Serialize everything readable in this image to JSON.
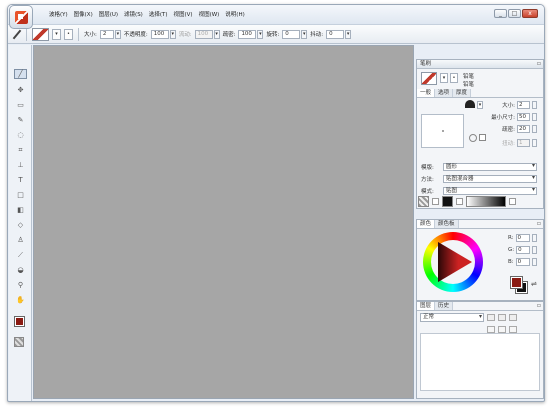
{
  "menu": [
    "波格(Y)",
    "图像(X)",
    "图层(U)",
    "滤镜(S)",
    "选择(T)",
    "视图(V)",
    "视图(W)",
    "说明(H)"
  ],
  "window_buttons": [
    "_",
    "□",
    "x"
  ],
  "options": {
    "size_label": "大小:",
    "size_value": "2",
    "opacity_label": "不透明度:",
    "opacity_value": "100",
    "flow_label": "流动:",
    "flow_value": "100",
    "density_label": "疏密:",
    "density_value": "100",
    "rotate_label": "旋转:",
    "rotate_value": "0",
    "offset_label": "抖动:",
    "offset_value": "0"
  },
  "brush_panel": {
    "title": "笔刷",
    "name_line1": "铅笔",
    "name_line2": "铅笔",
    "tabs": [
      "一般",
      "选项",
      "厚度"
    ],
    "rows": [
      {
        "label": "大小:",
        "value": "2"
      },
      {
        "label": "最小尺寸:",
        "value": "50"
      },
      {
        "label": "疏密:",
        "value": "20"
      },
      {
        "label": "扭动:",
        "value": "1"
      }
    ],
    "selects": [
      {
        "label": "模版:",
        "value": "圆形"
      },
      {
        "label": "方法:",
        "value": "贴图混合器"
      },
      {
        "label": "模式:",
        "value": "贴图"
      }
    ]
  },
  "color_panel": {
    "tabs": [
      "颜色",
      "颜色板"
    ],
    "r_label": "R:",
    "r_value": "0",
    "g_label": "G:",
    "g_value": "0",
    "b_label": "B:",
    "b_value": "0",
    "foreground": "#8a1a12",
    "background": "#111111"
  },
  "layer_panel": {
    "tabs": [
      "图层",
      "历史"
    ],
    "mode": "正常"
  },
  "tools": [
    "pencil-icon",
    "move-icon",
    "select-rect-icon",
    "brush-icon",
    "lasso-icon",
    "crop-icon",
    "stamp-icon",
    "text-icon",
    "shape-icon",
    "gradient-icon",
    "eraser-icon",
    "smudge-icon",
    "eyedropper-icon",
    "fill-icon",
    "zoom-icon",
    "hand-icon"
  ],
  "colors": {
    "canvas": "#a6a6a6",
    "chrome": "#e8eef6"
  }
}
